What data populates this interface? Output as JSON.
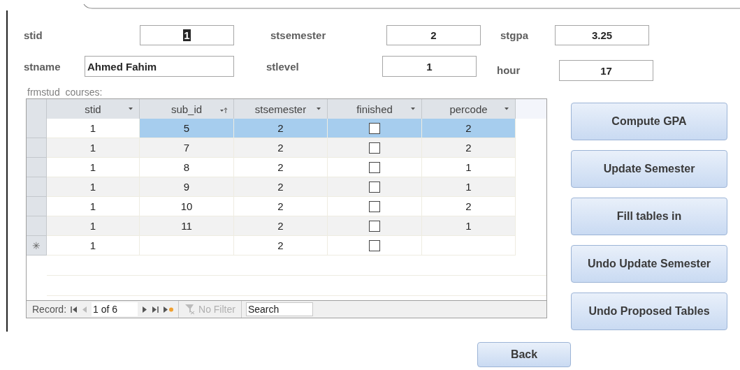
{
  "fields_row_1": [
    {
      "label": "stid",
      "value": "1",
      "selected": true
    },
    {
      "label": "stsemester",
      "value": "2",
      "selected": false
    },
    {
      "label": "stgpa",
      "value": "3.25",
      "selected": false
    }
  ],
  "fields_row_2": [
    {
      "label": "stname",
      "value": "Ahmed Fahim",
      "selected": false
    },
    {
      "label": "stlevel",
      "value": "1",
      "selected": false
    },
    {
      "label": "hour",
      "value": "17",
      "selected": false
    }
  ],
  "subform": {
    "label": "frmstud  courses:",
    "columns": [
      {
        "label": "stid",
        "sorted": false
      },
      {
        "label": "sub_id",
        "sorted": true
      },
      {
        "label": "stsemester",
        "sorted": false
      },
      {
        "label": "finished",
        "sorted": false
      },
      {
        "label": "percode",
        "sorted": false
      }
    ],
    "rows": [
      {
        "stid": "1",
        "sub_id": "5",
        "stsemester": "2",
        "finished": false,
        "percode": "2",
        "selected": true
      },
      {
        "stid": "1",
        "sub_id": "7",
        "stsemester": "2",
        "finished": false,
        "percode": "2",
        "selected": false
      },
      {
        "stid": "1",
        "sub_id": "8",
        "stsemester": "2",
        "finished": false,
        "percode": "1",
        "selected": false
      },
      {
        "stid": "1",
        "sub_id": "9",
        "stsemester": "2",
        "finished": false,
        "percode": "1",
        "selected": false
      },
      {
        "stid": "1",
        "sub_id": "10",
        "stsemester": "2",
        "finished": false,
        "percode": "2",
        "selected": false
      },
      {
        "stid": "1",
        "sub_id": "11",
        "stsemester": "2",
        "finished": false,
        "percode": "1",
        "selected": false
      }
    ],
    "new_row": {
      "marker": "✳",
      "stid": "1",
      "stsemester": "2",
      "finished": false
    },
    "navigation": {
      "label": "Record:",
      "position": "1 of 6",
      "filter": {
        "label": "No Filter",
        "disabled": true
      },
      "search": {
        "placeholder": "Search"
      }
    }
  },
  "buttons": [
    "Compute GPA",
    "Update Semester",
    "Fill tables in",
    "Undo Update Semester",
    "Undo Proposed Tables"
  ],
  "back_button": "Back"
}
